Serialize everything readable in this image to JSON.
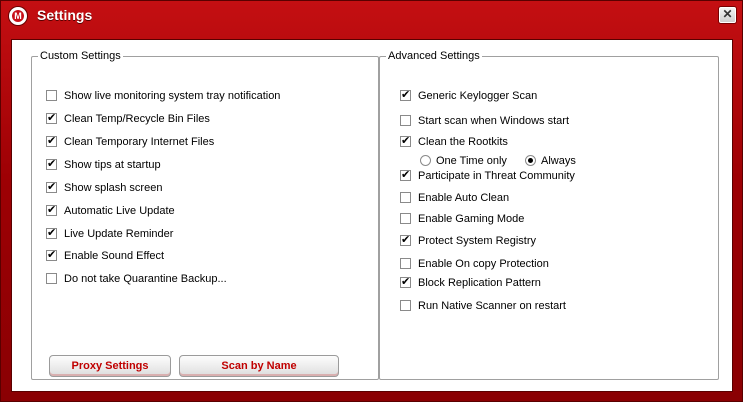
{
  "window": {
    "title": "Settings",
    "close_icon": "close-icon"
  },
  "custom": {
    "legend": "Custom Settings",
    "items": [
      {
        "label": "Show live monitoring system tray notification",
        "checked": false
      },
      {
        "label": "Clean Temp/Recycle Bin Files",
        "checked": true
      },
      {
        "label": "Clean Temporary Internet Files",
        "checked": true
      },
      {
        "label": "Show tips at startup",
        "checked": true
      },
      {
        "label": "Show splash screen",
        "checked": true
      },
      {
        "label": "Automatic Live Update",
        "checked": true
      },
      {
        "label": "Live Update Reminder",
        "checked": true
      },
      {
        "label": "Enable Sound Effect",
        "checked": true
      },
      {
        "label": "Do not take Quarantine Backup...",
        "checked": false
      }
    ],
    "buttons": {
      "proxy": "Proxy Settings",
      "scan_by_name": "Scan by Name"
    }
  },
  "advanced": {
    "legend": "Advanced Settings",
    "items": [
      {
        "label": "Generic Keylogger Scan",
        "checked": true
      },
      {
        "label": "Start scan when Windows start",
        "checked": false
      },
      {
        "label": "Clean the Rootkits",
        "checked": true
      },
      {
        "label": "Participate in Threat Community",
        "checked": true
      },
      {
        "label": "Enable Auto Clean",
        "checked": false
      },
      {
        "label": "Enable Gaming Mode",
        "checked": false
      },
      {
        "label": "Protect System Registry",
        "checked": true
      },
      {
        "label": "Enable On copy Protection",
        "checked": false
      },
      {
        "label": "Block Replication Pattern",
        "checked": true
      },
      {
        "label": "Run Native Scanner on restart",
        "checked": false
      }
    ],
    "rootkit_mode": {
      "options": [
        "One Time only",
        "Always"
      ],
      "selected": "Always"
    }
  },
  "colors": {
    "frame": "#9d0004",
    "button_text": "#c00000"
  }
}
